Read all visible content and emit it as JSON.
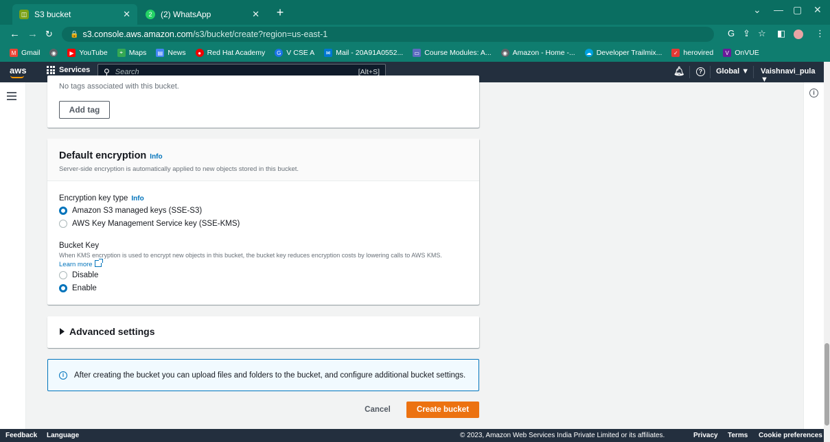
{
  "browser": {
    "tabs": [
      {
        "title": "S3 bucket",
        "favicon_color": "#7aa116"
      },
      {
        "title": "(2) WhatsApp",
        "favicon_color": "#25d366"
      }
    ],
    "new_tab_symbol": "+",
    "url_host": "s3.console.aws.amazon.com",
    "url_path": "/s3/bucket/create?region=us-east-1",
    "bookmarks": [
      {
        "label": "Gmail",
        "color": "#ea4335"
      },
      {
        "label": "",
        "color": "#5f6368"
      },
      {
        "label": "YouTube",
        "color": "#ff0000"
      },
      {
        "label": "Maps",
        "color": "#34a853"
      },
      {
        "label": "News",
        "color": "#4285f4"
      },
      {
        "label": "Red Hat Academy",
        "color": "#ee0000"
      },
      {
        "label": "V CSE A",
        "color": "#1a73e8"
      },
      {
        "label": "Mail - 20A91A0552...",
        "color": "#0078d4"
      },
      {
        "label": "Course Modules: A...",
        "color": "#5c6bc0"
      },
      {
        "label": "Amazon - Home -...",
        "color": "#5f6368"
      },
      {
        "label": "Developer Trailmix...",
        "color": "#00a1e0"
      },
      {
        "label": "herovired",
        "color": "#e53935"
      },
      {
        "label": "OnVUE",
        "color": "#6a1b9a"
      }
    ]
  },
  "aws_header": {
    "logo": "aws",
    "services": "Services",
    "search_placeholder": "Search",
    "search_shortcut": "[Alt+S]",
    "region": "Global ▼",
    "account": "Vaishnavi_pula ▼"
  },
  "tags": {
    "empty_text": "No tags associated with this bucket.",
    "add_tag": "Add tag"
  },
  "encryption": {
    "title": "Default encryption",
    "info": "Info",
    "description": "Server-side encryption is automatically applied to new objects stored in this bucket.",
    "key_type_label": "Encryption key type",
    "key_type_info": "Info",
    "option_sse_s3": "Amazon S3 managed keys (SSE-S3)",
    "option_sse_kms": "AWS Key Management Service key (SSE-KMS)",
    "bucket_key_label": "Bucket Key",
    "bucket_key_description": "When KMS encryption is used to encrypt new objects in this bucket, the bucket key reduces encryption costs by lowering calls to AWS KMS.",
    "learn_more": "Learn more",
    "disable": "Disable",
    "enable": "Enable"
  },
  "advanced": {
    "title": "Advanced settings"
  },
  "alert": {
    "text": "After creating the bucket you can upload files and folders to the bucket, and configure additional bucket settings."
  },
  "actions": {
    "cancel": "Cancel",
    "create": "Create bucket"
  },
  "footer": {
    "feedback": "Feedback",
    "language": "Language",
    "copyright": "© 2023, Amazon Web Services India Private Limited or its affiliates.",
    "privacy": "Privacy",
    "terms": "Terms",
    "cookie": "Cookie preferences"
  },
  "colors": {
    "aws_dark": "#232f3e",
    "primary_orange": "#ec7211",
    "link_blue": "#0073bb",
    "chrome_teal": "#0f7d6f"
  }
}
